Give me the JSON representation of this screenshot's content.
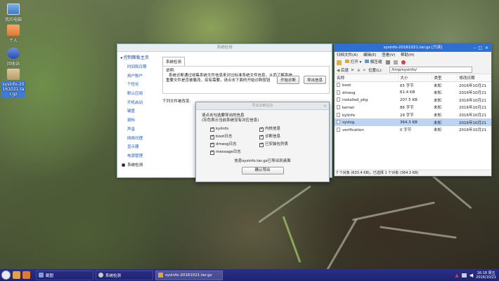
{
  "desktop": {
    "icons": [
      {
        "label": "我的电脑"
      },
      {
        "label": "个人"
      },
      {
        "label": "回收站"
      },
      {
        "label": "sysinfo-20161021.tar.gz"
      }
    ]
  },
  "control_panel": {
    "title": "系统检测",
    "back_link": "控制面板主页",
    "nav": [
      "时间和日期",
      "用户账户",
      "个性化",
      "默认应用",
      "开机启动",
      "键盘",
      "鼠标",
      "声音",
      "网络代理",
      "显示器",
      "电源管理",
      "系统检测"
    ],
    "tab": "系统检测",
    "desc_label": "说明:",
    "desc_line1": "系统诊断通过收集系统文件信息来对比标准系统文件信息，从而了解系统",
    "desc_line2": "重要文件是否被篡改，如有需要，请点击下面的开始诊断按钮",
    "start_button": "开始诊断",
    "export_button": "导出信息",
    "changes_label": "下列文件被改变:"
  },
  "export_dialog": {
    "title": "导出诊断信息",
    "prompt1": "请点击勾选要导出的信息",
    "prompt2": "(灰色表示当前系统没有对应信息)",
    "options": [
      "kylinfo",
      "内核信息",
      "boot日志",
      "诊断信息",
      "dmesg日志",
      "已安装包列表",
      "message日志"
    ],
    "status": "信息sysinfo.tar.gz已导出到桌面",
    "ok_button": "确认导出"
  },
  "archive": {
    "title": "sysinfo-20161021.tar.gz [只读]",
    "menu": [
      "归档文件(A)",
      "编辑(E)",
      "查看(V)",
      "帮助(H)"
    ],
    "open_label": "打开",
    "extract_label": "解压缩",
    "back_label": "后退",
    "location_label": "位置(L):",
    "location": "/tmp/sysinfo/",
    "columns": [
      "名称",
      "大小",
      "类型",
      "修改日期"
    ],
    "files": [
      {
        "name": "boot",
        "size": "65 字节",
        "type": "未知",
        "date": "2016年10月21"
      },
      {
        "name": "dmesg",
        "size": "61.4 KB",
        "type": "未知",
        "date": "2016年10月21"
      },
      {
        "name": "installed_pkg",
        "size": "207.5 KB",
        "type": "未知",
        "date": "2016年10月21"
      },
      {
        "name": "kernel",
        "size": "86 字节",
        "type": "未知",
        "date": "2016年10月21"
      },
      {
        "name": "kylinfo",
        "size": "29 字节",
        "type": "未知",
        "date": "2016年10月21"
      },
      {
        "name": "syslog",
        "size": "364.3 KB",
        "type": "未知",
        "date": "2016年10月21"
      },
      {
        "name": "verification",
        "size": "0 字节",
        "type": "未知",
        "date": "2016年10月21"
      }
    ],
    "status": "7 个对象 (633.4 KB)，已选择 1 个对象 (364.3 KB)"
  },
  "taskbar": {
    "tasks": [
      "截图",
      "系统检测",
      "sysinfo-20161021.tar.gz"
    ],
    "time": "16:18 周五",
    "date": "2016/10/21"
  }
}
